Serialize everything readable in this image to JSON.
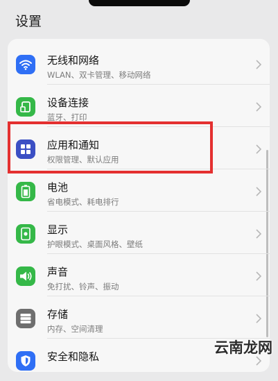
{
  "header": {
    "title": "设置"
  },
  "items": [
    {
      "title": "无线和网络",
      "subtitle": "WLAN、双卡管理、移动网络",
      "icon": "wifi-icon",
      "color": "#2f6ff5"
    },
    {
      "title": "设备连接",
      "subtitle": "蓝牙、打印",
      "icon": "device-connect-icon",
      "color": "#35b848"
    },
    {
      "title": "应用和通知",
      "subtitle": "权限管理、默认应用",
      "icon": "apps-grid-icon",
      "color": "#3b4fc4"
    },
    {
      "title": "电池",
      "subtitle": "省电模式、耗电排行",
      "icon": "battery-icon",
      "color": "#35b848"
    },
    {
      "title": "显示",
      "subtitle": "护眼模式、桌面风格、壁纸",
      "icon": "display-icon",
      "color": "#35b848"
    },
    {
      "title": "声音",
      "subtitle": "免打扰、铃声、振动",
      "icon": "sound-icon",
      "color": "#35b848"
    },
    {
      "title": "存储",
      "subtitle": "内存、空间清理",
      "icon": "storage-icon",
      "color": "#6e6e6e"
    },
    {
      "title": "安全和隐私",
      "subtitle": "",
      "icon": "shield-icon",
      "color": "#2f6ff5"
    }
  ],
  "highlight_color": "#e43030",
  "watermark": "云南龙网"
}
